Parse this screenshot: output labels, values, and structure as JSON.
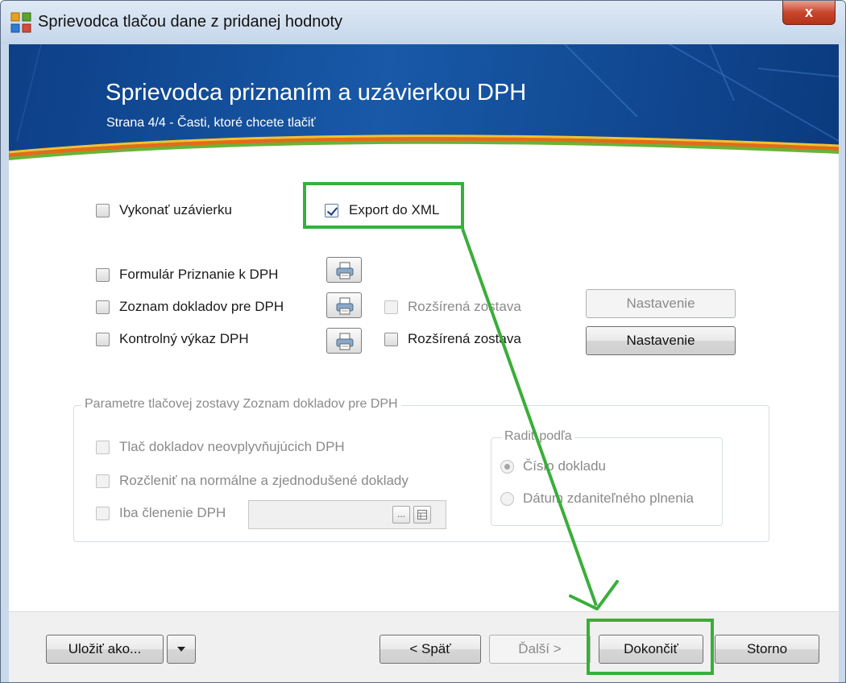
{
  "window": {
    "title": "Sprievodca tlačou dane z pridanej hodnoty",
    "close_label": "x"
  },
  "banner": {
    "title": "Sprievodca priznaním a uzávierkou DPH",
    "subtitle": "Strana 4/4 - Časti, ktoré chcete tlačiť"
  },
  "options": {
    "vykonat_uzavierku": {
      "label": "Vykonať uzávierku",
      "checked": false
    },
    "export_xml": {
      "label": "Export do XML",
      "checked": true
    },
    "formular": {
      "label": "Formulár Priznanie k DPH",
      "checked": false
    },
    "zoznam": {
      "label": "Zoznam dokladov pre DPH",
      "checked": false
    },
    "kontrolny": {
      "label": "Kontrolný výkaz DPH",
      "checked": false
    },
    "rozsirena_1": {
      "label": "Rozšírená zostava",
      "checked": false,
      "enabled": false
    },
    "rozsirena_2": {
      "label": "Rozšírená zostava",
      "checked": false,
      "enabled": true
    },
    "nastavenie_1": "Nastavenie",
    "nastavenie_2": "Nastavenie"
  },
  "params": {
    "group_title": "Parametre tlačovej zostavy Zoznam dokladov pre DPH",
    "tlac_dokladov": "Tlač dokladov neovplyvňujúcich DPH",
    "rozclenit": "Rozčleniť na normálne a zjednodušené doklady",
    "iba_clenenie": "Iba členenie DPH",
    "iba_clenenie_value": "",
    "ellipsis": "...",
    "sort": {
      "title": "Radiť podľa",
      "options": [
        "Číslo dokladu",
        "Dátum zdaniteľného plnenia"
      ],
      "selected": "Číslo dokladu"
    }
  },
  "footer": {
    "ulozit": "Uložiť ako...",
    "spat": "< Späť",
    "dalsi": "Ďalší >",
    "dokoncit": "Dokončiť",
    "storno": "Storno"
  },
  "colors": {
    "highlight": "#3aae3a",
    "banner": "#1859a8"
  }
}
